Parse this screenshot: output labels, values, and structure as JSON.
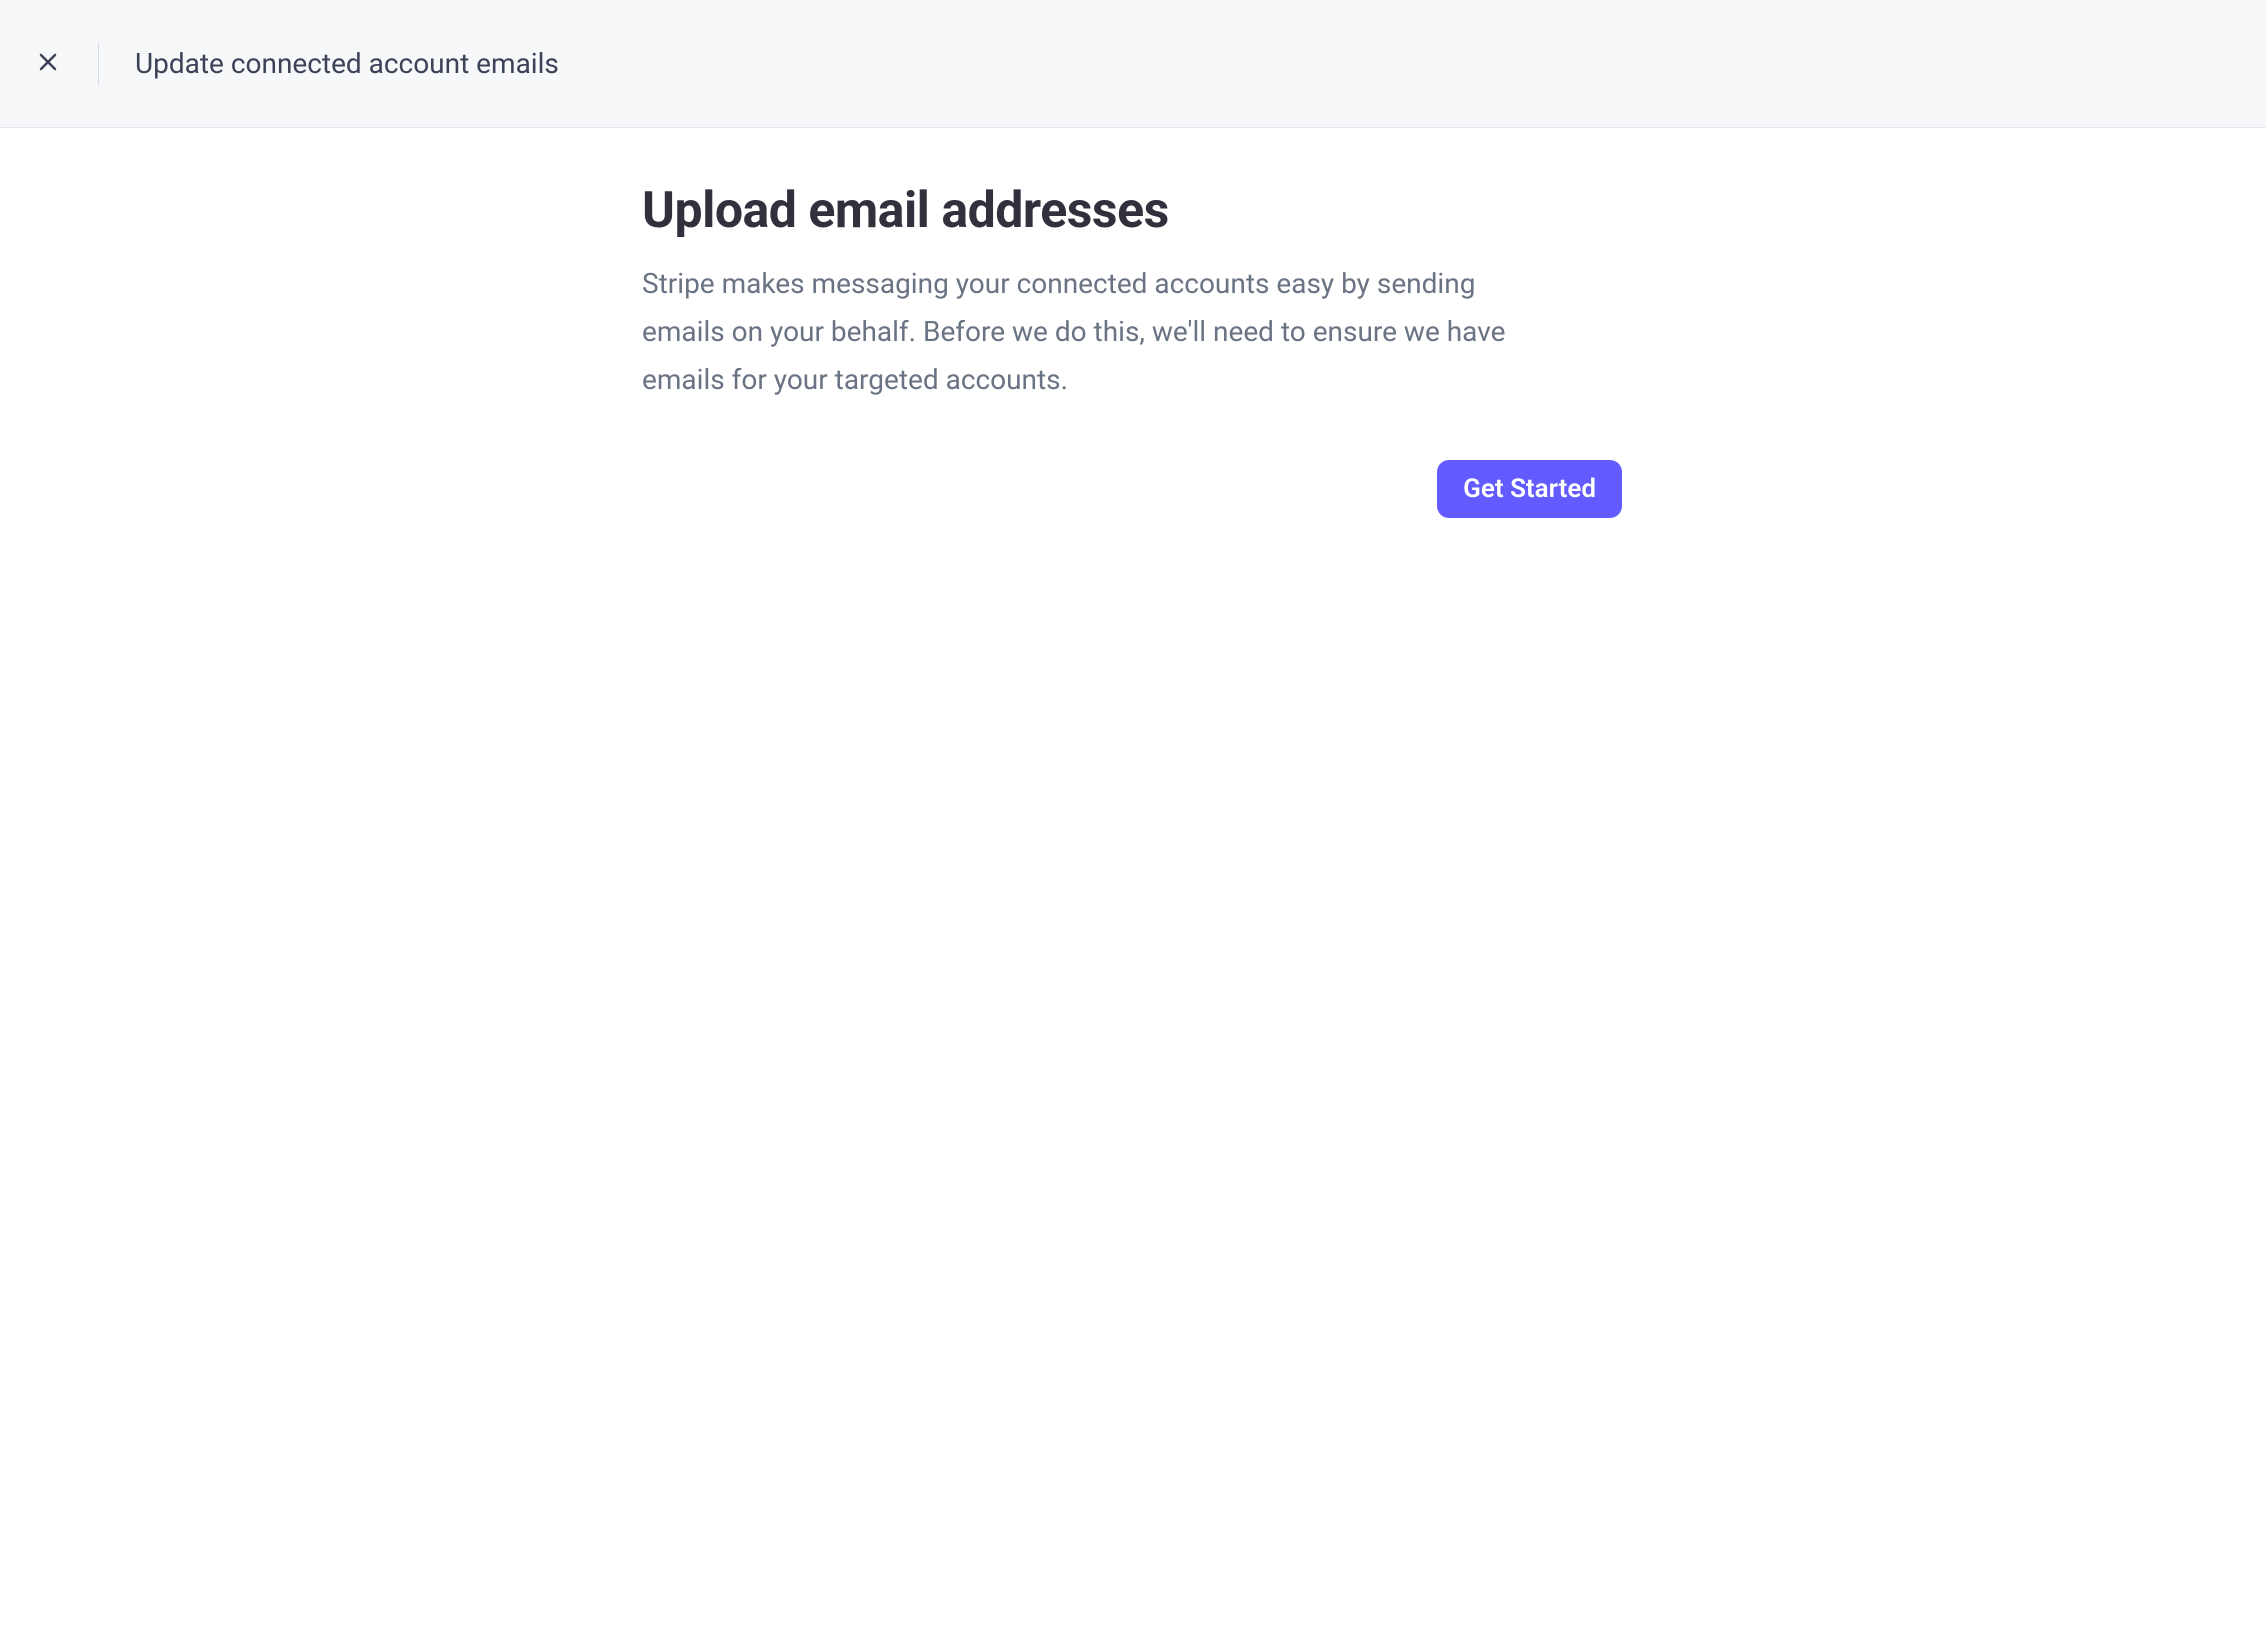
{
  "header": {
    "title": "Update connected account emails"
  },
  "main": {
    "title": "Upload email addresses",
    "description": "Stripe makes messaging your connected accounts easy by sending emails on your behalf. Before we do this, we'll need to ensure we have emails for your targeted accounts.",
    "primary_button": "Get Started"
  }
}
